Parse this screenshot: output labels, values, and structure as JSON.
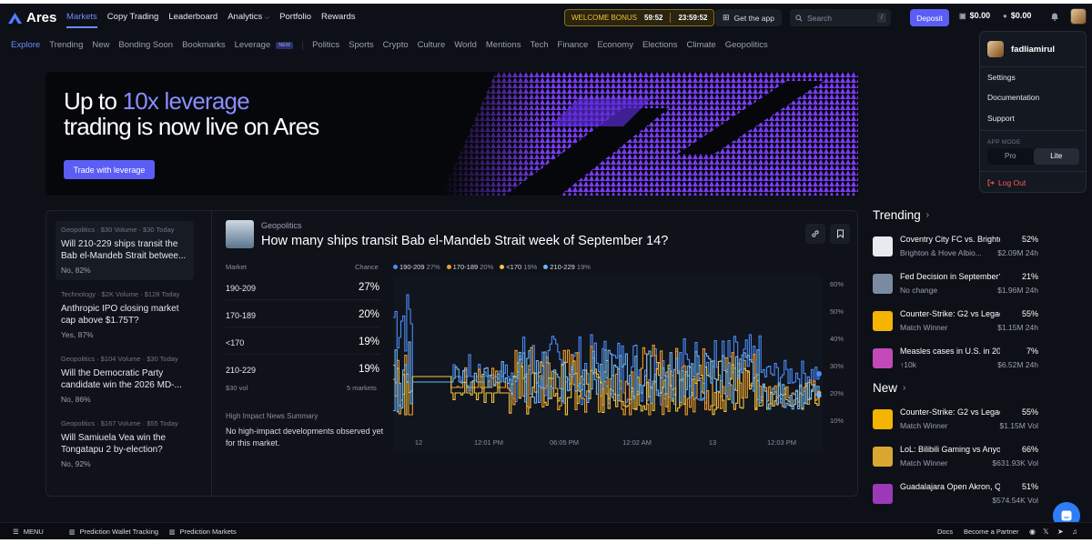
{
  "brand": {
    "name": "Ares"
  },
  "nav": {
    "links": [
      "Markets",
      "Copy Trading",
      "Leaderboard",
      "Analytics",
      "Portfolio",
      "Rewards"
    ],
    "active": "Markets",
    "bonus_label": "WELCOME BONUS",
    "bonus_timer_1": "59:52",
    "bonus_timer_2": "23:59:52",
    "get_app": "Get the app",
    "search_placeholder": "Search",
    "search_shortcut": "/",
    "deposit": "Deposit",
    "balance_1": "$0.00",
    "balance_2": "$0.00"
  },
  "subnav": {
    "items": [
      "Explore",
      "Trending",
      "New",
      "Bonding Soon",
      "Bookmarks",
      "Leverage"
    ],
    "new_badge": "NEW",
    "categories": [
      "Politics",
      "Sports",
      "Crypto",
      "Culture",
      "World",
      "Mentions",
      "Tech",
      "Finance",
      "Economy",
      "Elections",
      "Climate",
      "Geopolitics"
    ]
  },
  "banner": {
    "line1_prefix": "Up to ",
    "line1_highlight": "10x leverage",
    "line2": "trading is now live on Ares",
    "button": "Trade with leverage"
  },
  "markets": [
    {
      "meta": "Geopolitics · $30 Volume · $30 Today",
      "title": "Will 210-229 ships transit the Bab el-Mandeb Strait betwee...",
      "sub": "No, 82%"
    },
    {
      "meta": "Technology · $2K Volume · $128 Today",
      "title": "Anthropic IPO closing market cap above $1.75T?",
      "sub": "Yes, 87%"
    },
    {
      "meta": "Geopolitics · $104 Volume · $30 Today",
      "title": "Will the Democratic Party candidate win the 2026 MD-...",
      "sub": "No, 86%"
    },
    {
      "meta": "Geopolitics · $167 Volume · $55 Today",
      "title": "Will Samiuela Vea win the Tongatapu 2 by-election?",
      "sub": "No, 92%"
    }
  ],
  "detail": {
    "category": "Geopolitics",
    "title": "How many ships transit Bab el-Mandeb Strait week of September 14?",
    "col_market": "Market",
    "col_chance": "Chance",
    "rows": [
      {
        "name": "190-209",
        "chance": "27%"
      },
      {
        "name": "170-189",
        "chance": "20%"
      },
      {
        "name": "<170",
        "chance": "19%"
      },
      {
        "name": "210-229",
        "chance": "19%"
      }
    ],
    "vol": "$30 vol",
    "markets_count": "5 markets",
    "news_heading": "High Impact News Summary",
    "news_body": "No high-impact developments observed yet for this market."
  },
  "chart_data": {
    "type": "line",
    "legend": [
      {
        "name": "190-209",
        "pct": "27%",
        "color": "#4a8cf7"
      },
      {
        "name": "170-189",
        "pct": "20%",
        "color": "#f59e2a"
      },
      {
        "name": "<170",
        "pct": "19%",
        "color": "#f5c542"
      },
      {
        "name": "210-229",
        "pct": "19%",
        "color": "#6fb6f5"
      }
    ],
    "y_ticks": [
      "60%",
      "50%",
      "40%",
      "30%",
      "20%",
      "10%"
    ],
    "x_ticks": [
      "12",
      "12:01 PM",
      "06:05 PM",
      "12:02 AM",
      "13",
      "12:03 PM"
    ],
    "ylim": [
      10,
      60
    ],
    "series": [
      {
        "name": "190-209",
        "end_value": 27,
        "color": "#4a8cf7"
      },
      {
        "name": "170-189",
        "end_value": 20,
        "color": "#f59e2a"
      },
      {
        "name": "<170",
        "end_value": 19,
        "color": "#f5c542"
      },
      {
        "name": "210-229",
        "end_value": 19,
        "color": "#6fb6f5"
      }
    ]
  },
  "trending": {
    "heading": "Trending",
    "items": [
      {
        "title": "Coventry City FC vs. Brighto...",
        "pct": "52%",
        "sub": "Brighton & Hove Albio...",
        "vol": "$2.09M 24h",
        "color": "#e8eaf0"
      },
      {
        "title": "Fed Decision in September?",
        "pct": "21%",
        "sub": "No change",
        "vol": "$1.96M 24h",
        "color": "#7a8aa0"
      },
      {
        "title": "Counter-Strike: G2 vs Legac...",
        "pct": "55%",
        "sub": "Match Winner",
        "vol": "$1.15M 24h",
        "color": "#f5b400"
      },
      {
        "title": "Measles cases in U.S. in 2026?",
        "pct": "7%",
        "sub": "↑10k",
        "vol": "$6.52M 24h",
        "color": "#c24ab8"
      }
    ]
  },
  "new": {
    "heading": "New",
    "items": [
      {
        "title": "Counter-Strike: G2 vs Legac...",
        "pct": "55%",
        "sub": "Match Winner",
        "vol": "$1.15M Vol",
        "color": "#f5b400"
      },
      {
        "title": "LoL: Bilibili Gaming vs Anyon...",
        "pct": "66%",
        "sub": "Match Winner",
        "vol": "$631.93K Vol",
        "color": "#d9a632"
      },
      {
        "title": "Guadalajara Open Akron, Qu...",
        "pct": "51%",
        "sub": "",
        "vol": "$574.54K Vol",
        "color": "#9b3ab8"
      }
    ]
  },
  "dropdown": {
    "username": "fadliamirul",
    "items": [
      "Settings",
      "Documentation",
      "Support"
    ],
    "mode_label": "APP MODE",
    "mode_pro": "Pro",
    "mode_lite": "Lite",
    "logout": "Log Out"
  },
  "bottombar": {
    "menu": "MENU",
    "wallet": "Prediction Wallet Tracking",
    "markets": "Prediction Markets",
    "docs": "Docs",
    "partner": "Become a Partner"
  }
}
